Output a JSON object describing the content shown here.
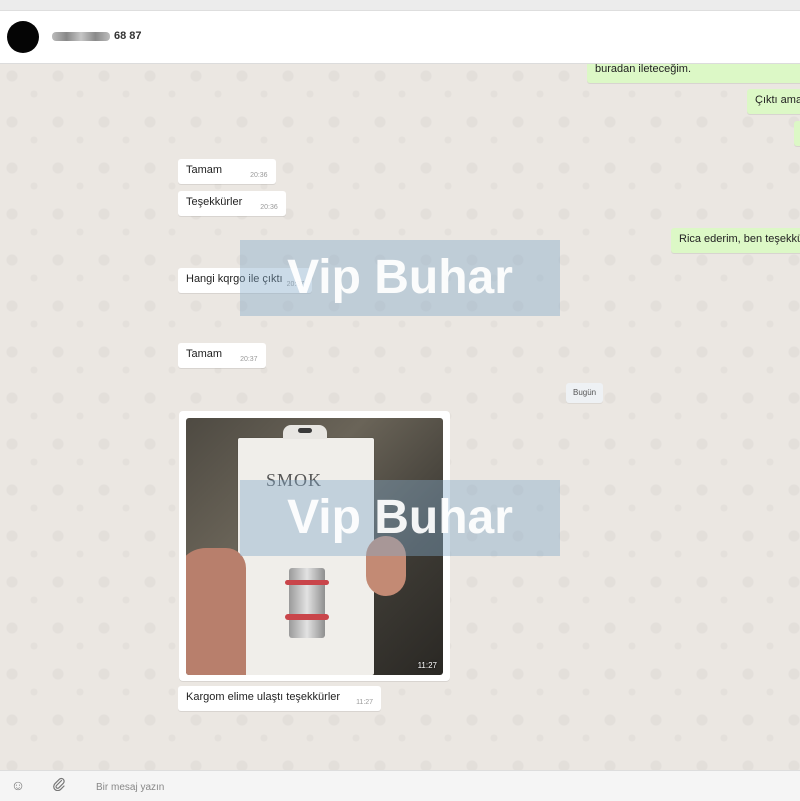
{
  "header": {
    "contact_suffix": "68 87"
  },
  "messages": {
    "out_1": {
      "text": "buradan ileteceğim."
    },
    "out_2": {
      "text": "Çıktı ama"
    },
    "in_1": {
      "text": "Tamam",
      "time": "20:36"
    },
    "in_2": {
      "text": "Teşekkürler",
      "time": "20:36"
    },
    "out_3": {
      "text": "Rica ederim, ben teşekkü"
    },
    "in_3": {
      "text": "Hangi kqrgo ile çıktı",
      "time": "20:37"
    },
    "in_4": {
      "text": "Tamam",
      "time": "20:37"
    },
    "date_separator": "Bugün",
    "photo": {
      "brand": "SMOK",
      "time": "11:27"
    },
    "in_5": {
      "text": "Kargom elime ulaştı teşekkürler",
      "time": "11:27"
    }
  },
  "watermark": {
    "text": "Vip Buhar"
  },
  "footer": {
    "placeholder": "Bir mesaj yazın",
    "emoji_icon": "emoji-icon",
    "attach_icon": "paperclip-icon"
  },
  "colors": {
    "incoming_bubble": "#ffffff",
    "outgoing_bubble": "#dcf8c6",
    "chat_background": "#ebe7e2",
    "watermark_band": "#82aac8"
  }
}
